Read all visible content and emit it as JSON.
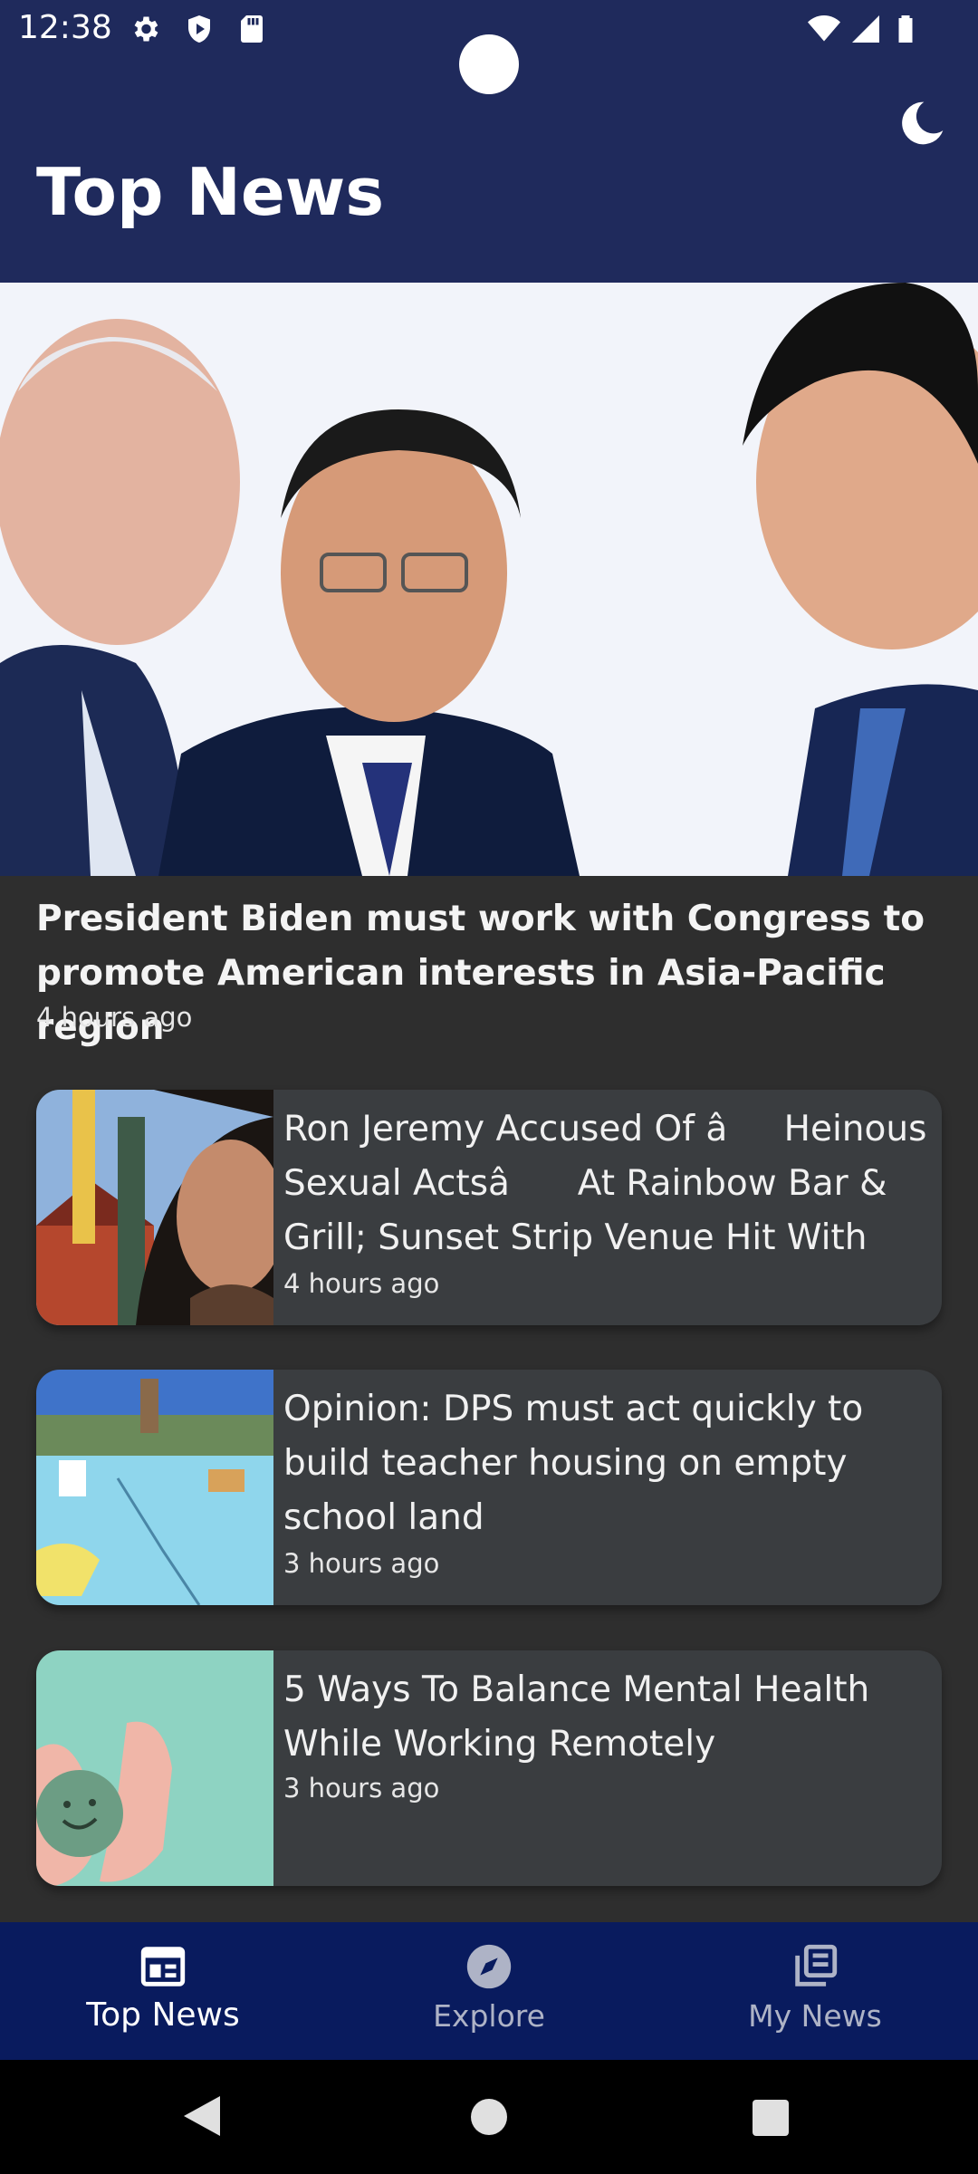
{
  "status_bar": {
    "time": "12:38",
    "left_icons": [
      "gear-icon",
      "shield-play-icon",
      "sd-card-icon"
    ],
    "right_icons": [
      "wifi-icon",
      "signal-icon",
      "battery-icon"
    ]
  },
  "header": {
    "title": "Top News",
    "theme_icon": "moon-icon",
    "background": "#1f2a5c"
  },
  "hero": {
    "title": "President Biden must work with Congress to promote American interests in Asia-Pacific region",
    "time": "4 hours ago"
  },
  "articles": [
    {
      "title": "Ron Jeremy Accused Of âHeinous Sexual Actsâ At Rainbow Bar & Grill; Sunset Strip Venue Hit With Ne…",
      "time": "4 hours ago"
    },
    {
      "title": "Opinion: DPS must act quickly to build teacher housing on empty school land",
      "time": "3 hours ago"
    },
    {
      "title": "5 Ways To Balance Mental Health While Working Remotely",
      "time": "3 hours ago"
    }
  ],
  "bottom_nav": {
    "background": "#091b5e",
    "items": [
      {
        "label": "Top News",
        "icon": "newspaper-icon",
        "active": true
      },
      {
        "label": "Explore",
        "icon": "compass-icon",
        "active": false
      },
      {
        "label": "My News",
        "icon": "library-icon",
        "active": false
      }
    ]
  },
  "system_nav": [
    "back-icon",
    "home-icon",
    "recents-icon"
  ]
}
